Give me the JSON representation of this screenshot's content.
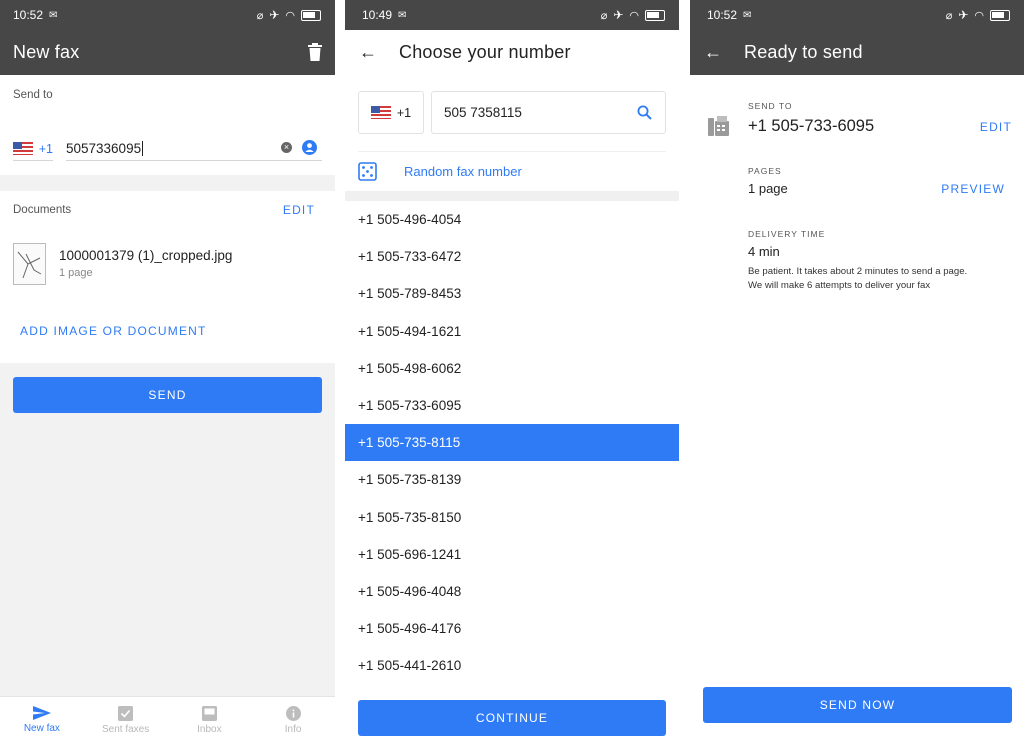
{
  "screen1": {
    "status_time": "10:52",
    "title": "New fax",
    "send_to_label": "Send to",
    "country_code": "+1",
    "fax_number_value": "5057336095",
    "documents_label": "Documents",
    "documents_edit": "EDIT",
    "document": {
      "name": "1000001379 (1)_cropped.jpg",
      "pages": "1 page"
    },
    "add_document": "ADD IMAGE OR DOCUMENT",
    "send_button": "SEND",
    "nav": [
      {
        "label": "New fax",
        "icon": "send-icon",
        "active": true
      },
      {
        "label": "Sent faxes",
        "icon": "checkbox-icon",
        "active": false
      },
      {
        "label": "Inbox",
        "icon": "inbox-icon",
        "active": false
      },
      {
        "label": "Info",
        "icon": "info-icon",
        "active": false
      }
    ]
  },
  "screen2": {
    "status_time": "10:49",
    "title": "Choose your number",
    "country_code": "+1",
    "search_value": "505 7358115",
    "random_label": "Random fax number",
    "numbers": [
      "+1 505-496-4054",
      "+1 505-733-6472",
      "+1 505-789-8453",
      "+1 505-494-1621",
      "+1 505-498-6062",
      "+1 505-733-6095",
      "+1 505-735-8115",
      "+1 505-735-8139",
      "+1 505-735-8150",
      "+1 505-696-1241",
      "+1 505-496-4048",
      "+1 505-496-4176",
      "+1 505-441-2610"
    ],
    "selected_number": "+1 505-735-8115",
    "continue_button": "CONTINUE"
  },
  "screen3": {
    "status_time": "10:52",
    "title": "Ready to send",
    "send_to_label": "SEND TO",
    "send_to_value": "+1 505-733-6095",
    "edit_link": "EDIT",
    "pages_label": "PAGES",
    "pages_value": "1 page",
    "preview_link": "PREVIEW",
    "delivery_label": "DELIVERY TIME",
    "delivery_value": "4 min",
    "delivery_note_1": "Be patient. It takes about 2 minutes to send a page.",
    "delivery_note_2": "We will make 6 attempts to deliver your fax",
    "send_now_button": "SEND NOW"
  },
  "colors": {
    "accent": "#2f7bf5",
    "appbar": "#474747",
    "background": "#f2f2f2"
  }
}
